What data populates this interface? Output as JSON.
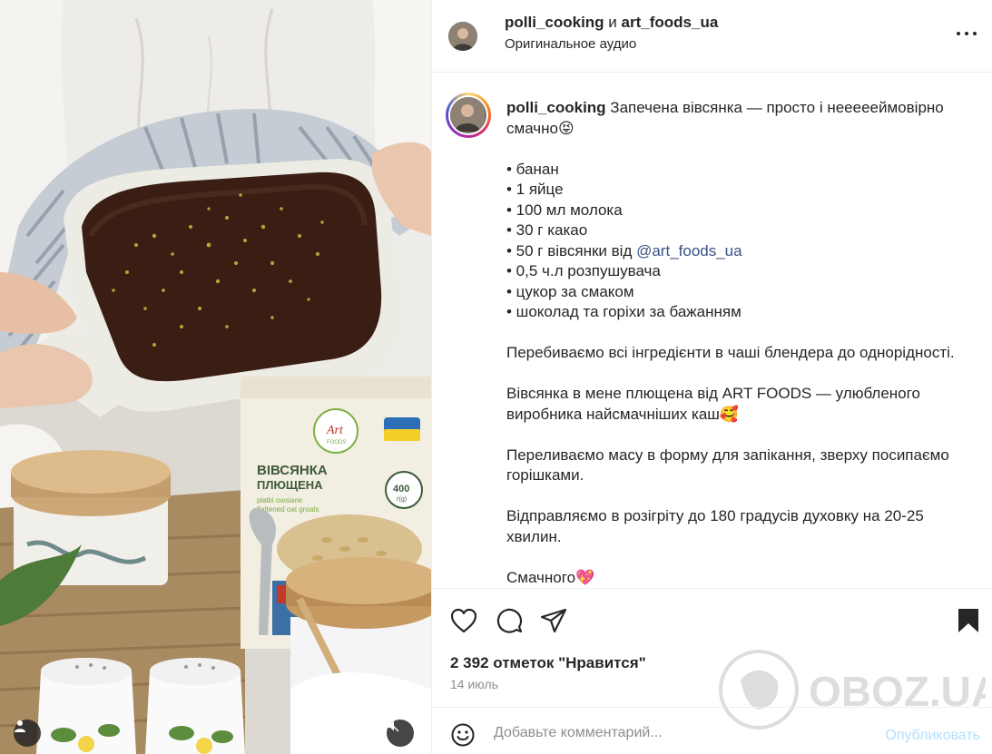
{
  "header": {
    "user1": "polli_cooking",
    "conjunction": "и",
    "user2": "art_foods_ua",
    "audio": "Оригинальное аудио"
  },
  "caption": {
    "username": "polli_cooking",
    "intro": "Запечена вівсянка — просто і неееееймовірно смачно😝",
    "ingredients": [
      "• банан",
      "• 1 яйце",
      "• 100 мл молока",
      "• 30 г какао",
      "• 50 г вівсянки від ",
      "• 0,5 ч.л розпушувача",
      "• цукор за смаком",
      "• шоколад та горіхи за бажанням"
    ],
    "mention": "@art_foods_ua",
    "step1": "Перебиваємо всі інгредієнти в чаші блендера до однорідності.",
    "step2": "Вівсянка в мене плющена від ART FOODS — улюбленого виробника найсмачніших каш🥰",
    "step3": "Переливаємо масу в форму для запікання, зверху посипаємо горішками.",
    "step4": "Відправляємо в розігріту до 180 градусів духовку на 20-25 хвилин.",
    "outro": "Смачного💖"
  },
  "media": {
    "package_title_1": "ВІВСЯНКА",
    "package_title_2": "ПЛЮЩЕНА",
    "package_sub_1": "płatki owsiane",
    "package_sub_2": "flattened oat groats",
    "package_weight": "400",
    "package_weight_unit": "г(g)",
    "brand": "Art",
    "brand_sub": "FOODS"
  },
  "actions": {
    "likes": "2 392 отметок \"Нравится\"",
    "date": "14 июль"
  },
  "comment": {
    "placeholder": "Добавьте комментарий...",
    "post_label": "Опубликовать"
  },
  "watermark": "OBOZ.UA",
  "icons": {
    "like": "heart-icon",
    "comment": "comment-icon",
    "share": "share-icon",
    "save": "bookmark-icon",
    "emoji": "emoji-icon",
    "more": "more-icon",
    "tag": "user-tag-icon",
    "mute": "mute-icon"
  }
}
